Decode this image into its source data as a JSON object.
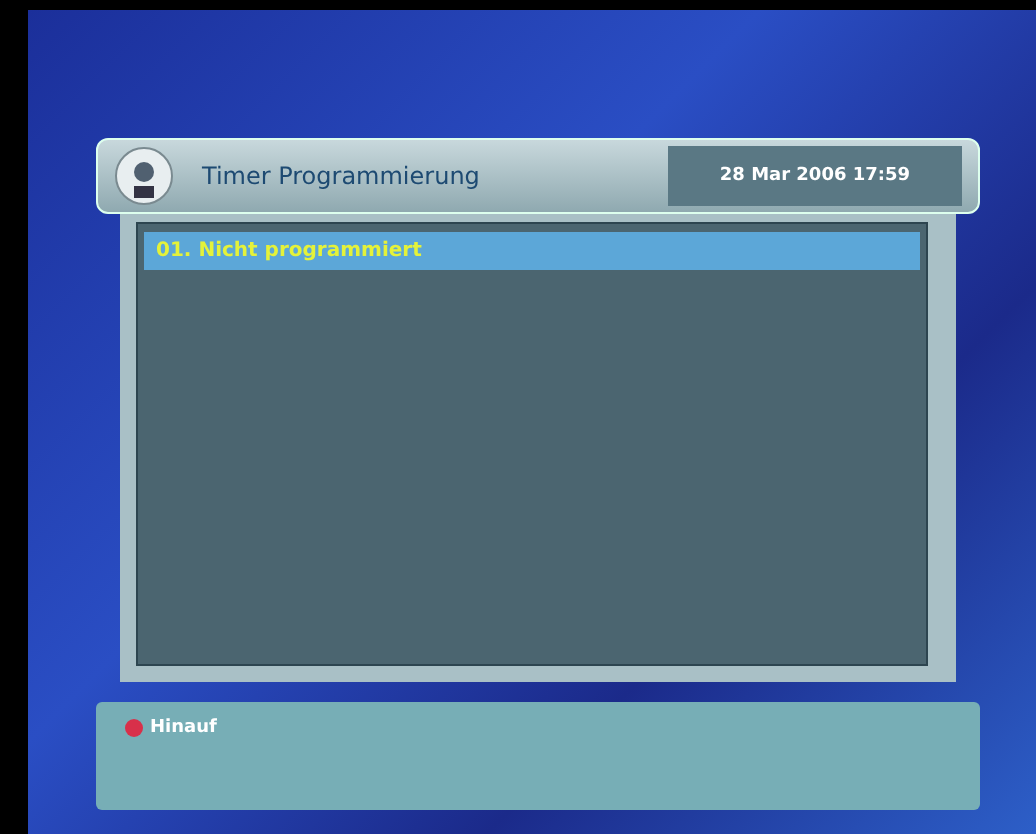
{
  "header": {
    "title": "Timer Programmierung",
    "datetime": "28 Mar 2006 17:59"
  },
  "list": {
    "rows": [
      {
        "label": "01. Nicht programmiert",
        "selected": true
      }
    ]
  },
  "footer": {
    "hint": "Hinauf"
  }
}
